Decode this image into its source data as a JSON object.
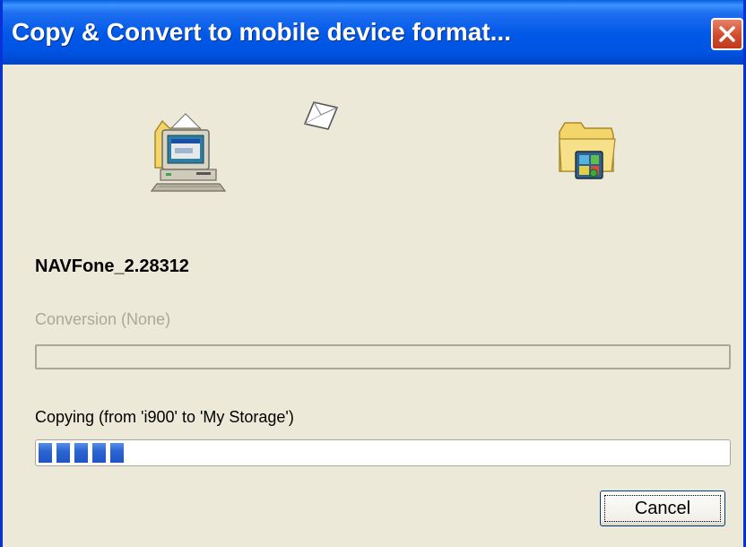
{
  "window": {
    "title": "Copy & Convert to mobile device format..."
  },
  "icons": {
    "source": "computer-icon",
    "transfer": "flying-document-icon",
    "destination": "mobile-device-folder-icon",
    "close": "close-icon"
  },
  "item": {
    "name": "NAVFone_2.28312"
  },
  "conversion": {
    "label": "Conversion (None)",
    "progress": 0
  },
  "copying": {
    "label": "Copying (from 'i900' to 'My Storage')",
    "progress": 0.13
  },
  "buttons": {
    "cancel_label": "Cancel"
  },
  "colors": {
    "titlebar": "#0054e3",
    "close": "#d34a2b",
    "progress_fill": "#2b66d3",
    "dialog_bg": "#ece9d8"
  }
}
